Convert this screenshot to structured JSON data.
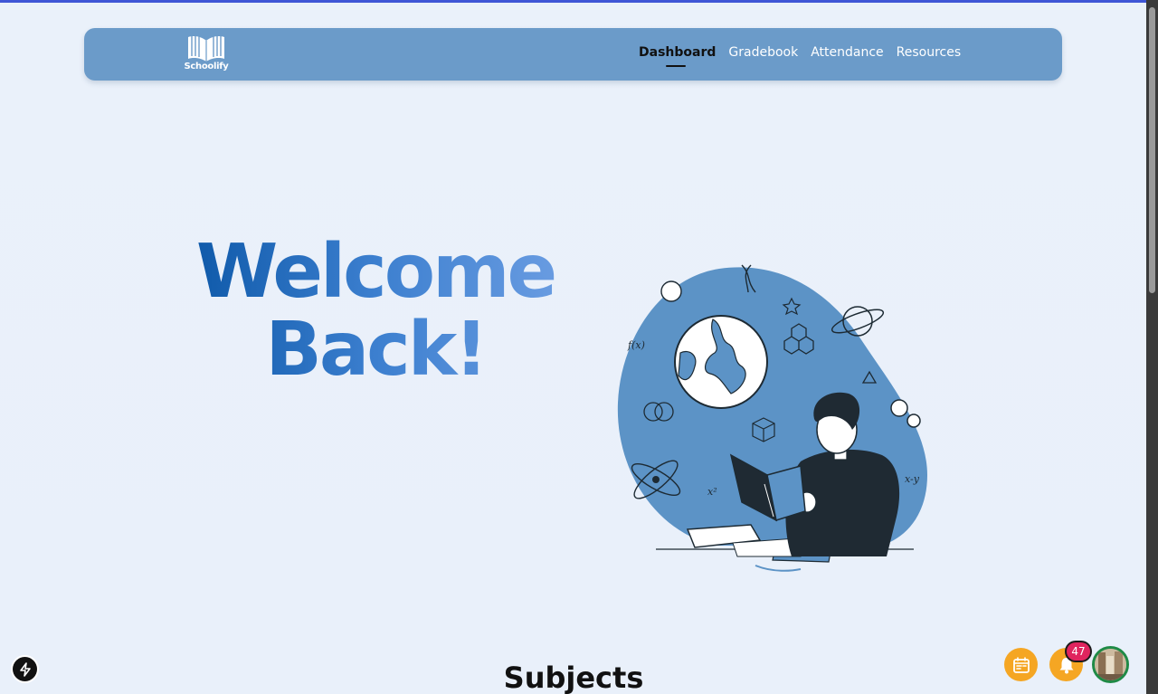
{
  "app": {
    "logo_text": "Schoolify",
    "accent_color": "#3f56d6",
    "nav_color": "#6b9bc9"
  },
  "nav": {
    "items": [
      {
        "label": "Dashboard",
        "active": true
      },
      {
        "label": "Gradebook",
        "active": false
      },
      {
        "label": "Attendance",
        "active": false
      },
      {
        "label": "Resources",
        "active": false
      }
    ]
  },
  "hero": {
    "line1": "Welcome",
    "line2": "Back!",
    "illustration": "student-reading-book-with-science-icons"
  },
  "sections": {
    "subjects_title": "Subjects"
  },
  "floating": {
    "calendar_icon": "calendar-icon",
    "bell_icon": "bell-icon",
    "notification_count": "47",
    "avatar": "user-avatar"
  },
  "dev_badge": "next-js-icon"
}
